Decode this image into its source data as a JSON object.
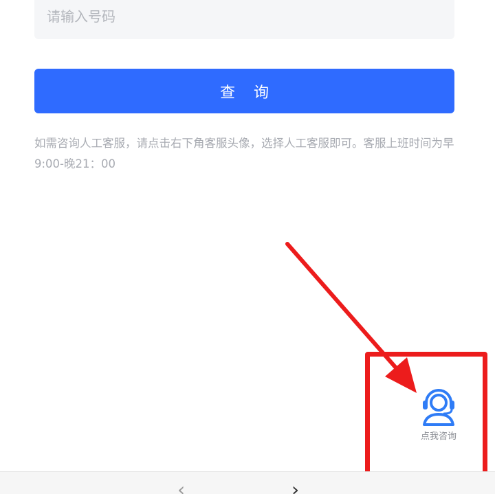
{
  "phone_input": {
    "placeholder": "请输入号码",
    "value": ""
  },
  "query_button": {
    "label": "查 询"
  },
  "notice": {
    "text": "如需咨询人工客服，请点击右下角客服头像，选择人工客服即可。客服上班时间为早9:00-晚21：00"
  },
  "service_widget": {
    "icon": "customer-service-headset-icon",
    "label": "点我咨询"
  },
  "annotation": {
    "arrow_color": "#ec1c1c",
    "box_color": "#ec1c1c"
  },
  "bottom_bar": {
    "back_icon": "chevron-left-icon",
    "forward_icon": "chevron-right-icon"
  },
  "colors": {
    "accent": "#2f6bff",
    "input_bg": "#f5f6f8",
    "notice_text": "#a8abb2"
  }
}
